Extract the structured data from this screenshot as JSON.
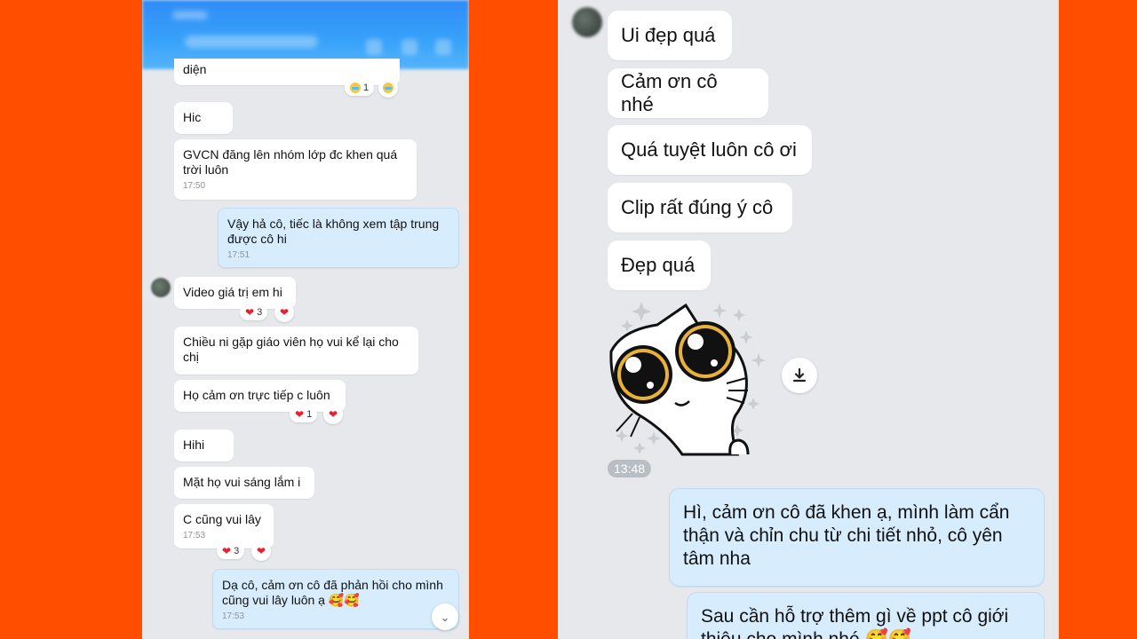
{
  "left_chat": {
    "messages": [
      {
        "text": "diện",
        "reaction_count": "1"
      },
      {
        "text": "Hic"
      },
      {
        "text": "GVCN đăng lên nhóm lớp đc khen quá trời luôn",
        "time": "17:50"
      },
      {
        "text": "Vậy hả cô, tiếc là không xem tập trung được cô hi",
        "time": "17:51"
      },
      {
        "text": "Video giá trị em hi",
        "reaction_count": "3"
      },
      {
        "text": "Chiều ni gặp giáo viên họ vui kể lại cho chị"
      },
      {
        "text": "Họ cảm ơn trực tiếp c luôn",
        "reaction_count": "1"
      },
      {
        "text": "Hihi"
      },
      {
        "text": "Mặt họ vui sáng lắm i"
      },
      {
        "text": "C cũng vui lây",
        "time": "17:53",
        "reaction_count": "3"
      },
      {
        "text": "Dạ cô, cảm ơn cô đã phản hồi cho mình cũng vui lây luôn ạ 🥰🥰",
        "time": "17:53"
      }
    ]
  },
  "right_chat": {
    "messages": [
      {
        "text": "Ui đẹp quá"
      },
      {
        "text": "Cảm ơn cô nhé"
      },
      {
        "text": "Quá tuyệt luôn cô ơi"
      },
      {
        "text": "Clip rất đúng ý cô"
      },
      {
        "text": "Đẹp quá"
      }
    ],
    "sticker_time": "13:48",
    "reply_1": "Hì, cảm ơn cô đã khen ạ, mình làm cẩn thận và chỉn chu từ chi tiết nhỏ, cô yên tâm nha",
    "reply_2": "Sau cần hỗ trợ thêm gì về ppt cô giới thiệu cho mình nhé 🥰🥰"
  },
  "icons": {
    "reaction_heart": "heart-icon",
    "reaction_cry": "crying-face-icon",
    "download": "download-icon",
    "scroll_down": "chevron-double-down-icon"
  },
  "colors": {
    "background": "#ff4e00",
    "header_blue": "#2f8cf8",
    "bubble_incoming": "#ffffff",
    "bubble_outgoing": "#d7ecfd",
    "heart": "#e8202b"
  }
}
